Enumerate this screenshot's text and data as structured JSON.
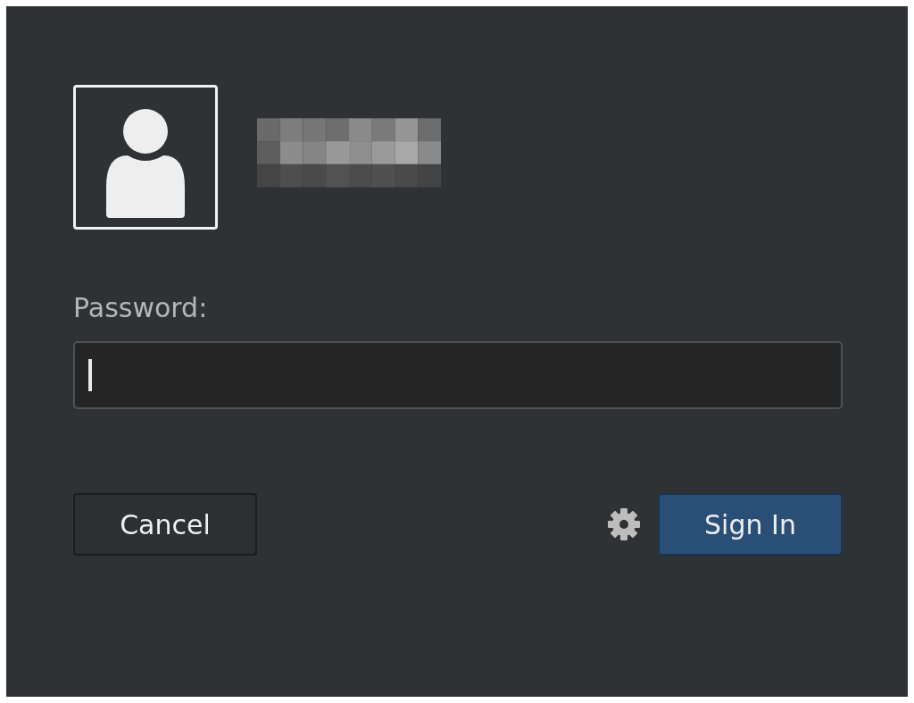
{
  "password": {
    "label": "Password:"
  },
  "buttons": [
    {
      "label": "Cancel",
      "kind": "default"
    },
    {
      "label": "Sign In",
      "kind": "primary"
    }
  ]
}
